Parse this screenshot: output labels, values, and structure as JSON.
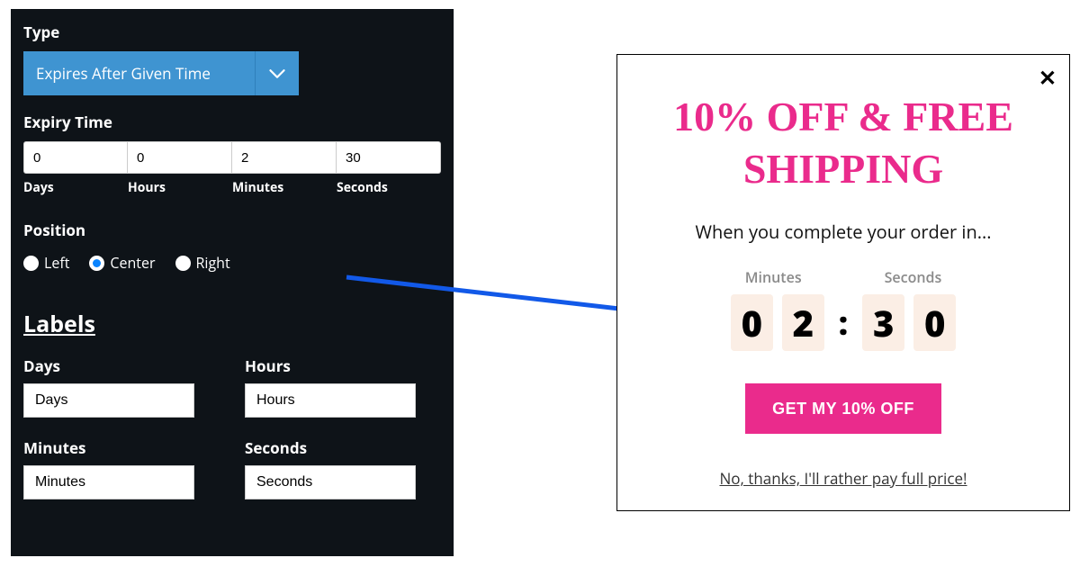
{
  "settings": {
    "type_label": "Type",
    "type_value": "Expires After Given Time",
    "expiry": {
      "heading": "Expiry Time",
      "days": {
        "value": "0",
        "unit": "Days"
      },
      "hours": {
        "value": "0",
        "unit": "Hours"
      },
      "minutes": {
        "value": "2",
        "unit": "Minutes"
      },
      "seconds": {
        "value": "30",
        "unit": "Seconds"
      }
    },
    "position": {
      "heading": "Position",
      "options": {
        "left": "Left",
        "center": "Center",
        "right": "Right"
      },
      "selected": "center"
    },
    "labels": {
      "heading": "Labels",
      "days": {
        "label": "Days",
        "value": "Days"
      },
      "hours": {
        "label": "Hours",
        "value": "Hours"
      },
      "minutes": {
        "label": "Minutes",
        "value": "Minutes"
      },
      "seconds": {
        "label": "Seconds",
        "value": "Seconds"
      }
    }
  },
  "preview": {
    "close": "✕",
    "title": "10% OFF & FREE SHIPPING",
    "subtitle": "When you complete your order in...",
    "timer_label_minutes": "Minutes",
    "timer_label_seconds": "Seconds",
    "digits": {
      "m1": "0",
      "m2": "2",
      "s1": "3",
      "s2": "0",
      "colon": ":"
    },
    "cta": "GET MY 10% OFF",
    "decline": "No, thanks, I'll rather pay full price!"
  },
  "colors": {
    "panel_bg": "#0e1318",
    "dropdown": "#3f94d1",
    "accent": "#ea2b8c",
    "digit_bg": "#fbeee5",
    "arrow": "#1259e8"
  }
}
